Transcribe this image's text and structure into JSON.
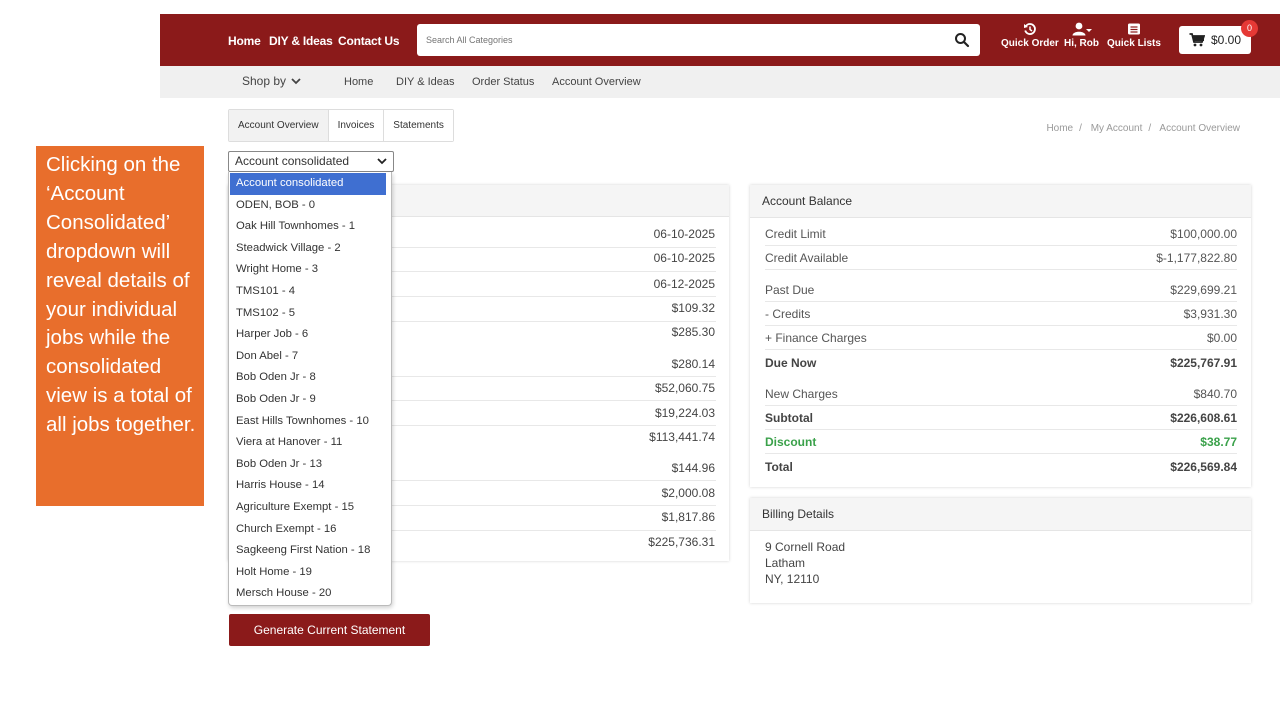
{
  "header": {
    "nav": [
      "Home",
      "DIY & Ideas",
      "Contact Us"
    ],
    "search_placeholder": "Search All Categories",
    "quick_order": "Quick Order",
    "user": "Hi, Rob",
    "quick_lists": "Quick Lists",
    "cart_total": "$0.00",
    "cart_count": "0"
  },
  "subnav": {
    "shop_by": "Shop by",
    "items": [
      "Home",
      "DIY & Ideas",
      "Order Status",
      "Account Overview"
    ]
  },
  "tabs": [
    "Account Overview",
    "Invoices",
    "Statements"
  ],
  "breadcrumb": [
    "Home",
    "My Account",
    "Account Overview"
  ],
  "account_select": {
    "value": "Account consolidated",
    "options": [
      "Account consolidated",
      "ODEN, BOB - 0",
      "Oak Hill Townhomes - 1",
      "Steadwick Village - 2",
      "Wright Home - 3",
      "TMS101 - 4",
      "TMS102 - 5",
      "Harper Job - 6",
      "Don Abel - 7",
      "Bob Oden Jr - 8",
      "Bob Oden Jr - 9",
      "East Hills Townhomes - 10",
      "Viera at Hanover - 11",
      "Bob Oden Jr - 13",
      "Harris House - 14",
      "Agriculture Exempt - 15",
      "Church Exempt - 16",
      "Sagkeeng First Nation - 18",
      "Holt Home - 19",
      "Mersch House - 20"
    ]
  },
  "summary_values": [
    "06-10-2025",
    "06-10-2025",
    "06-12-2025",
    "$109.32",
    "$285.30",
    "$280.14",
    "$52,060.75",
    "$19,224.03",
    "$113,441.74",
    "$144.96",
    "$2,000.08",
    "$1,817.86",
    "$225,736.31"
  ],
  "balance": {
    "title": "Account Balance",
    "rows": [
      {
        "label": "Credit Limit",
        "value": "$100,000.00"
      },
      {
        "label": "Credit Available",
        "value": "$-1,177,822.80"
      },
      {
        "label": "Past Due",
        "value": "$229,699.21"
      },
      {
        "label": "- Credits",
        "value": "$3,931.30"
      },
      {
        "label": "+ Finance Charges",
        "value": "$0.00"
      },
      {
        "label": "Due Now",
        "value": "$225,767.91"
      },
      {
        "label": "New Charges",
        "value": "$840.70"
      },
      {
        "label": "Subtotal",
        "value": "$226,608.61"
      },
      {
        "label": "Discount",
        "value": "$38.77"
      },
      {
        "label": "Total",
        "value": "$226,569.84"
      }
    ]
  },
  "billing": {
    "title": "Billing Details",
    "lines": [
      "9 Cornell Road",
      "Latham",
      "NY, 12110"
    ]
  },
  "generate_button": "Generate Current Statement",
  "callout_text": "Clicking on the ‘Account Consolidated’ dropdown will reveal details of your individual jobs while the consolidated view is a total of all jobs together.",
  "colors": {
    "brand": "#8b1a1a",
    "callout": "#e86e2c",
    "select_highlight": "#3f6fd1",
    "discount": "#3aa14a",
    "badge": "#e53935"
  }
}
